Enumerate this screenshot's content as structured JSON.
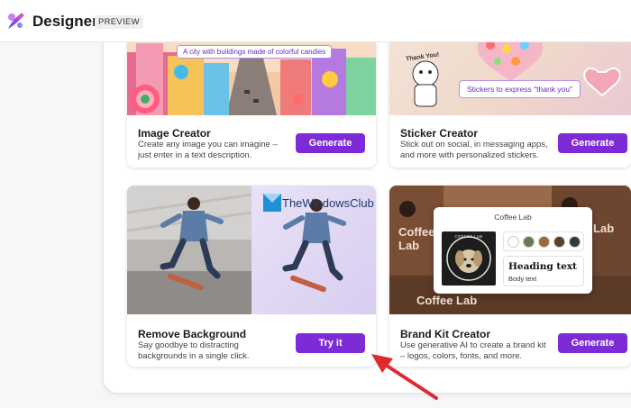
{
  "app": {
    "name": "Designer",
    "badge": "PREVIEW"
  },
  "cards": {
    "image_creator": {
      "title": "Image Creator",
      "desc": "Create any image you can imagine – just enter in a text description.",
      "button": "Generate",
      "prompt": "A city with buildings made of colorful candies"
    },
    "sticker_creator": {
      "title": "Sticker Creator",
      "desc": "Stick out on social, in messaging apps, and more with personalized stickers.",
      "button": "Generate",
      "prompt": "Stickers to express \"thank you\"",
      "sticker_text": "Thank You!"
    },
    "remove_background": {
      "title": "Remove Background",
      "desc": "Say goodbye to distracting backgrounds in a single click.",
      "button": "Try it",
      "watermark": "TheWindowsClub"
    },
    "brand_kit": {
      "title": "Brand Kit Creator",
      "desc": "Use generative AI to create a brand kit – logos, colors, fonts, and more.",
      "button": "Generate",
      "popup_title": "Coffee Lab",
      "logo_text": "COFFEE LAB",
      "heading_sample": "Heading text",
      "body_sample": "Body text",
      "bg_text": "Coffee Lab",
      "swatches": [
        "#ffffff",
        "#6b7a55",
        "#9a6b3c",
        "#5c3f2c",
        "#2e3b3a"
      ]
    }
  },
  "colors": {
    "accent": "#7c2bd6",
    "annotation_arrow": "#e0282e"
  }
}
